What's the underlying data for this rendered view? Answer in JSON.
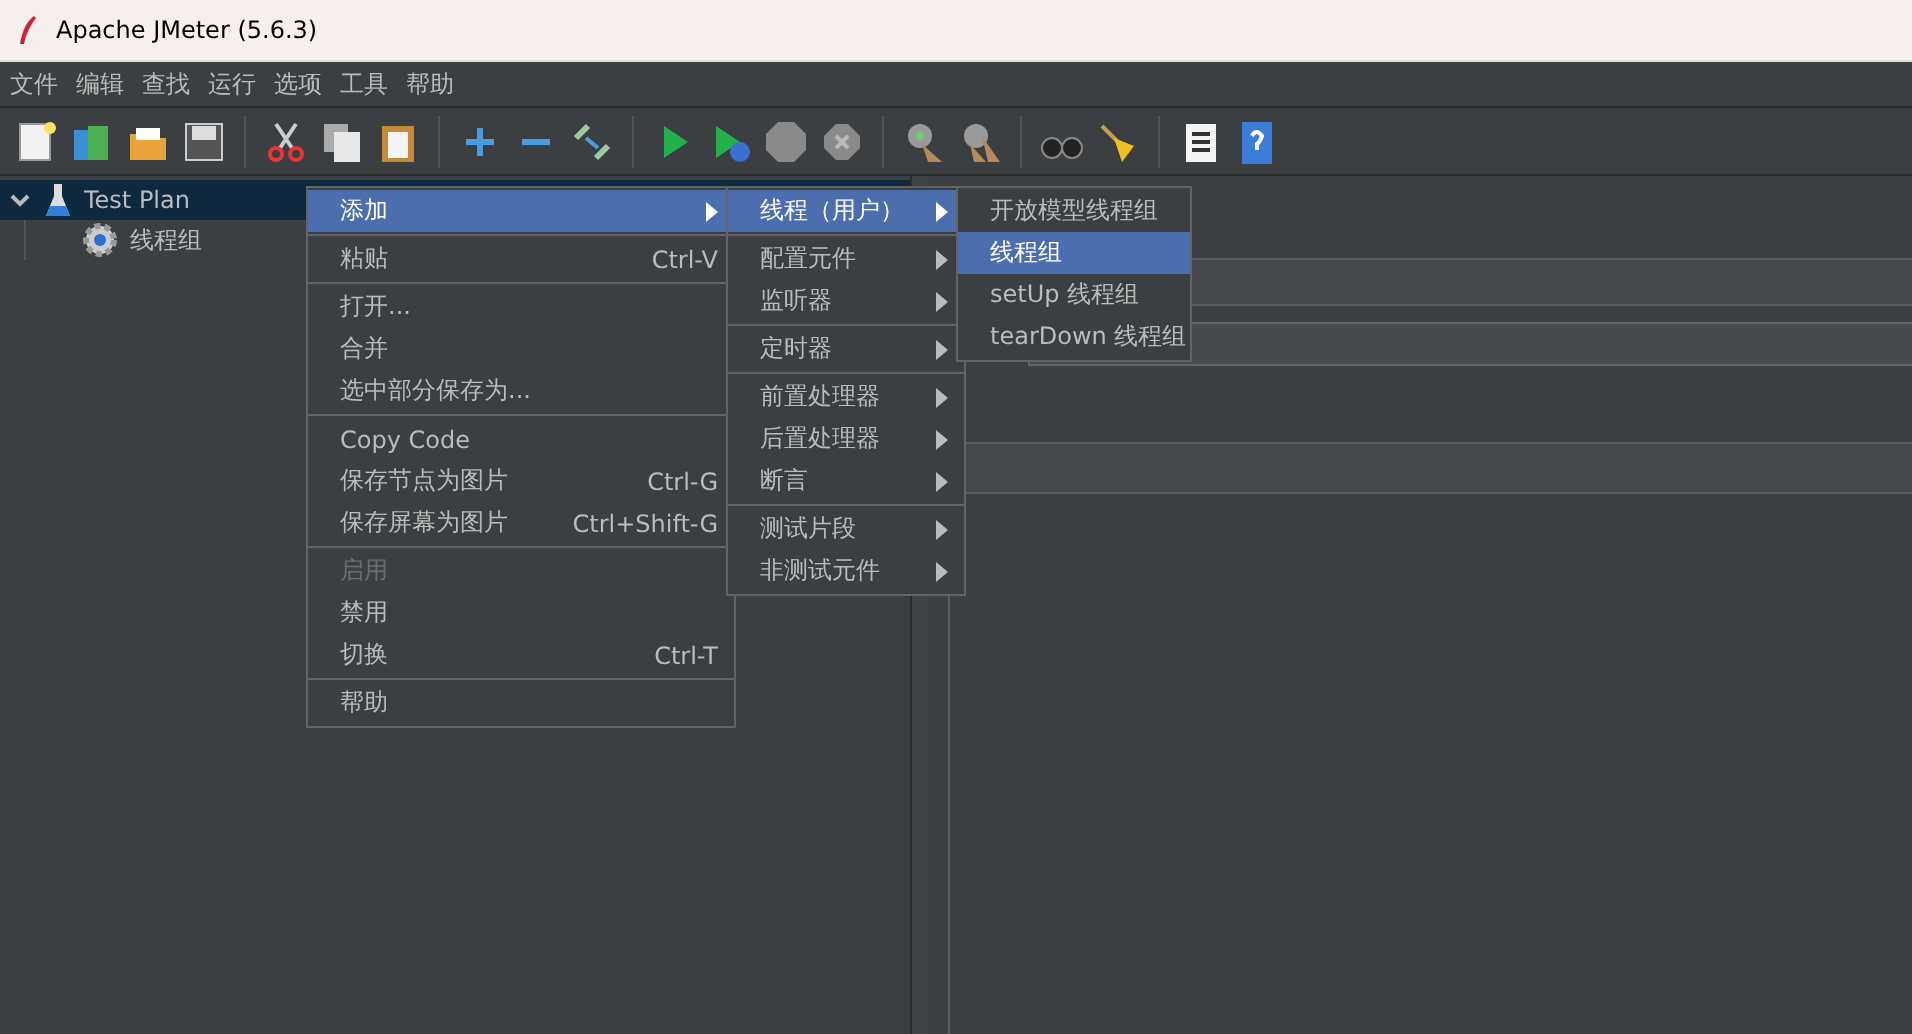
{
  "window": {
    "title": "Apache JMeter (5.6.3)"
  },
  "menu_bar": [
    "文件",
    "编辑",
    "查找",
    "运行",
    "选项",
    "工具",
    "帮助"
  ],
  "tree": [
    {
      "label": "Test Plan",
      "kind": "plan",
      "expanded": true,
      "selected": true,
      "children": [
        {
          "label": "线程组",
          "kind": "thread-group",
          "selected": false
        }
      ]
    }
  ],
  "context_menus": [
    {
      "groups": [
        [
          {
            "label": "添加",
            "submenu": true,
            "selected": true,
            "disabled": false
          }
        ],
        [
          {
            "label": "粘贴",
            "shortcut": "Ctrl-V",
            "submenu": false,
            "selected": false,
            "disabled": false
          }
        ],
        [
          {
            "label": "打开...",
            "submenu": false,
            "selected": false,
            "disabled": false
          },
          {
            "label": "合并",
            "submenu": false,
            "selected": false,
            "disabled": false
          },
          {
            "label": "选中部分保存为...",
            "submenu": false,
            "selected": false,
            "disabled": false
          }
        ],
        [
          {
            "label": "Copy Code",
            "submenu": false,
            "selected": false,
            "disabled": false
          },
          {
            "label": "保存节点为图片",
            "shortcut": "Ctrl-G",
            "submenu": false,
            "selected": false,
            "disabled": false
          },
          {
            "label": "保存屏幕为图片",
            "shortcut": "Ctrl+Shift-G",
            "submenu": false,
            "selected": false,
            "disabled": false
          }
        ],
        [
          {
            "label": "启用",
            "submenu": false,
            "selected": false,
            "disabled": true
          },
          {
            "label": "禁用",
            "submenu": false,
            "selected": false,
            "disabled": false
          },
          {
            "label": "切换",
            "shortcut": "Ctrl-T",
            "submenu": false,
            "selected": false,
            "disabled": false
          }
        ],
        [
          {
            "label": "帮助",
            "submenu": false,
            "selected": false,
            "disabled": false
          }
        ]
      ]
    },
    {
      "groups": [
        [
          {
            "label": "线程（用户）",
            "submenu": true,
            "selected": true,
            "disabled": false
          }
        ],
        [
          {
            "label": "配置元件",
            "submenu": true,
            "selected": false,
            "disabled": false
          },
          {
            "label": "监听器",
            "submenu": true,
            "selected": false,
            "disabled": false
          }
        ],
        [
          {
            "label": "定时器",
            "submenu": true,
            "selected": false,
            "disabled": false
          }
        ],
        [
          {
            "label": "前置处理器",
            "submenu": true,
            "selected": false,
            "disabled": false
          },
          {
            "label": "后置处理器",
            "submenu": true,
            "selected": false,
            "disabled": false
          },
          {
            "label": "断言",
            "submenu": true,
            "selected": false,
            "disabled": false
          }
        ],
        [
          {
            "label": "测试片段",
            "submenu": true,
            "selected": false,
            "disabled": false
          },
          {
            "label": "非测试元件",
            "submenu": true,
            "selected": false,
            "disabled": false
          }
        ]
      ]
    },
    {
      "groups": [
        [
          {
            "label": "开放模型线程组",
            "submenu": false,
            "selected": false,
            "disabled": false
          },
          {
            "label": "线程组",
            "submenu": false,
            "selected": true,
            "disabled": false
          },
          {
            "label": "setUp 线程组",
            "submenu": false,
            "selected": false,
            "disabled": false
          },
          {
            "label": "tearDown 线程组",
            "submenu": false,
            "selected": false,
            "disabled": false
          }
        ]
      ]
    }
  ]
}
